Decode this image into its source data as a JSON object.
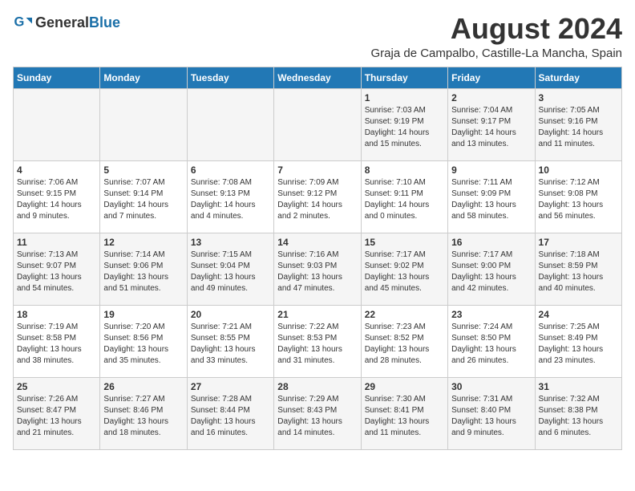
{
  "header": {
    "logo_general": "General",
    "logo_blue": "Blue",
    "main_title": "August 2024",
    "subtitle": "Graja de Campalbo, Castille-La Mancha, Spain"
  },
  "weekdays": [
    "Sunday",
    "Monday",
    "Tuesday",
    "Wednesday",
    "Thursday",
    "Friday",
    "Saturday"
  ],
  "weeks": [
    [
      {
        "day": "",
        "info": ""
      },
      {
        "day": "",
        "info": ""
      },
      {
        "day": "",
        "info": ""
      },
      {
        "day": "",
        "info": ""
      },
      {
        "day": "1",
        "info": "Sunrise: 7:03 AM\nSunset: 9:19 PM\nDaylight: 14 hours\nand 15 minutes."
      },
      {
        "day": "2",
        "info": "Sunrise: 7:04 AM\nSunset: 9:17 PM\nDaylight: 14 hours\nand 13 minutes."
      },
      {
        "day": "3",
        "info": "Sunrise: 7:05 AM\nSunset: 9:16 PM\nDaylight: 14 hours\nand 11 minutes."
      }
    ],
    [
      {
        "day": "4",
        "info": "Sunrise: 7:06 AM\nSunset: 9:15 PM\nDaylight: 14 hours\nand 9 minutes."
      },
      {
        "day": "5",
        "info": "Sunrise: 7:07 AM\nSunset: 9:14 PM\nDaylight: 14 hours\nand 7 minutes."
      },
      {
        "day": "6",
        "info": "Sunrise: 7:08 AM\nSunset: 9:13 PM\nDaylight: 14 hours\nand 4 minutes."
      },
      {
        "day": "7",
        "info": "Sunrise: 7:09 AM\nSunset: 9:12 PM\nDaylight: 14 hours\nand 2 minutes."
      },
      {
        "day": "8",
        "info": "Sunrise: 7:10 AM\nSunset: 9:11 PM\nDaylight: 14 hours\nand 0 minutes."
      },
      {
        "day": "9",
        "info": "Sunrise: 7:11 AM\nSunset: 9:09 PM\nDaylight: 13 hours\nand 58 minutes."
      },
      {
        "day": "10",
        "info": "Sunrise: 7:12 AM\nSunset: 9:08 PM\nDaylight: 13 hours\nand 56 minutes."
      }
    ],
    [
      {
        "day": "11",
        "info": "Sunrise: 7:13 AM\nSunset: 9:07 PM\nDaylight: 13 hours\nand 54 minutes."
      },
      {
        "day": "12",
        "info": "Sunrise: 7:14 AM\nSunset: 9:06 PM\nDaylight: 13 hours\nand 51 minutes."
      },
      {
        "day": "13",
        "info": "Sunrise: 7:15 AM\nSunset: 9:04 PM\nDaylight: 13 hours\nand 49 minutes."
      },
      {
        "day": "14",
        "info": "Sunrise: 7:16 AM\nSunset: 9:03 PM\nDaylight: 13 hours\nand 47 minutes."
      },
      {
        "day": "15",
        "info": "Sunrise: 7:17 AM\nSunset: 9:02 PM\nDaylight: 13 hours\nand 45 minutes."
      },
      {
        "day": "16",
        "info": "Sunrise: 7:17 AM\nSunset: 9:00 PM\nDaylight: 13 hours\nand 42 minutes."
      },
      {
        "day": "17",
        "info": "Sunrise: 7:18 AM\nSunset: 8:59 PM\nDaylight: 13 hours\nand 40 minutes."
      }
    ],
    [
      {
        "day": "18",
        "info": "Sunrise: 7:19 AM\nSunset: 8:58 PM\nDaylight: 13 hours\nand 38 minutes."
      },
      {
        "day": "19",
        "info": "Sunrise: 7:20 AM\nSunset: 8:56 PM\nDaylight: 13 hours\nand 35 minutes."
      },
      {
        "day": "20",
        "info": "Sunrise: 7:21 AM\nSunset: 8:55 PM\nDaylight: 13 hours\nand 33 minutes."
      },
      {
        "day": "21",
        "info": "Sunrise: 7:22 AM\nSunset: 8:53 PM\nDaylight: 13 hours\nand 31 minutes."
      },
      {
        "day": "22",
        "info": "Sunrise: 7:23 AM\nSunset: 8:52 PM\nDaylight: 13 hours\nand 28 minutes."
      },
      {
        "day": "23",
        "info": "Sunrise: 7:24 AM\nSunset: 8:50 PM\nDaylight: 13 hours\nand 26 minutes."
      },
      {
        "day": "24",
        "info": "Sunrise: 7:25 AM\nSunset: 8:49 PM\nDaylight: 13 hours\nand 23 minutes."
      }
    ],
    [
      {
        "day": "25",
        "info": "Sunrise: 7:26 AM\nSunset: 8:47 PM\nDaylight: 13 hours\nand 21 minutes."
      },
      {
        "day": "26",
        "info": "Sunrise: 7:27 AM\nSunset: 8:46 PM\nDaylight: 13 hours\nand 18 minutes."
      },
      {
        "day": "27",
        "info": "Sunrise: 7:28 AM\nSunset: 8:44 PM\nDaylight: 13 hours\nand 16 minutes."
      },
      {
        "day": "28",
        "info": "Sunrise: 7:29 AM\nSunset: 8:43 PM\nDaylight: 13 hours\nand 14 minutes."
      },
      {
        "day": "29",
        "info": "Sunrise: 7:30 AM\nSunset: 8:41 PM\nDaylight: 13 hours\nand 11 minutes."
      },
      {
        "day": "30",
        "info": "Sunrise: 7:31 AM\nSunset: 8:40 PM\nDaylight: 13 hours\nand 9 minutes."
      },
      {
        "day": "31",
        "info": "Sunrise: 7:32 AM\nSunset: 8:38 PM\nDaylight: 13 hours\nand 6 minutes."
      }
    ]
  ]
}
